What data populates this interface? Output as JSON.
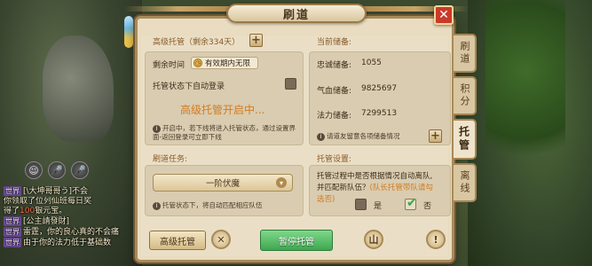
{
  "window": {
    "title": "刷道",
    "close_label": "✕"
  },
  "left_top": {
    "title": "高级托管（剩余334天）",
    "remaining_label": "剩余时间",
    "remaining_value": "有效期内无限",
    "auto_login_label": "托管状态下自动登录",
    "status_text": "高级托管开启中...",
    "note": "开启中，若下线将进入托管状态，通过设置界面-返回登录可立即下线"
  },
  "right_top": {
    "title": "当前储备:",
    "rows": [
      {
        "label": "忠诚储备:",
        "value": "1055"
      },
      {
        "label": "气血储备:",
        "value": "9825697"
      },
      {
        "label": "法力储备:",
        "value": "7299513"
      }
    ],
    "note": "请道友留意各项储备情况"
  },
  "left_bottom": {
    "title": "刷道任务:",
    "selected": "一阶伏魔",
    "note": "托管状态下，将自动匹配相应队伍"
  },
  "right_bottom": {
    "title": "托管设置:",
    "question_line1": "托管过程中是否根据情况自动离队,",
    "question_line2_a": "并匹配新队伍？",
    "question_line2_b": "(队长托管带队请勾",
    "question_line3": "选否)",
    "yes_label": "是",
    "no_label": "否",
    "selected": "否"
  },
  "bottom_bar": {
    "advanced_label": "高级托管",
    "pause_label": "暂停托管",
    "info_label": "!"
  },
  "tabs": [
    {
      "label": "刷道"
    },
    {
      "label": "积分"
    },
    {
      "label": "托管"
    },
    {
      "label": "离线"
    }
  ],
  "chat": [
    {
      "tag": "世界",
      "text": "[\\大坤哥哥う]不会"
    },
    {
      "tag": "",
      "text": "你领取了位列仙班每日奖"
    },
    {
      "tag": "",
      "pre": "得了",
      "hl": "100",
      "post": "银元宝。"
    },
    {
      "tag": "世界",
      "text": "[公主請發財]"
    },
    {
      "tag": "世界",
      "text": "雷霆，你的良心真的不会痛"
    },
    {
      "tag": "世界",
      "text": "由于你的法力低于基础数"
    }
  ],
  "chat_icons": [
    "☺",
    "🎤",
    "🎤"
  ],
  "colors": {
    "panel_bg": "#e9dcc0",
    "status_orange": "#d47b1e",
    "green_button": "#3fa651",
    "close_red": "#c93a2a"
  }
}
